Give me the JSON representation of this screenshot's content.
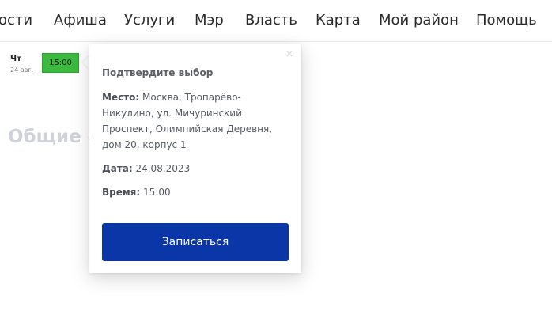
{
  "nav": {
    "items": [
      "ости",
      "Афиша",
      "Услуги",
      "Мэр",
      "Власть",
      "Карта",
      "Мой район",
      "Помощь"
    ]
  },
  "schedule": {
    "day_name": "Чт",
    "day_date": "24 авг.",
    "slot_time": "15:00"
  },
  "section": {
    "heading": "Общие с"
  },
  "popup": {
    "close_glyph": "×",
    "title": "Подтвердите выбор",
    "place_label": "Место:",
    "place_value": "Москва, Тропарёво-Никулино, ул. Мичуринский Проспект, Олимпийская Деревня, дом 20, корпус 1",
    "date_label": "Дата:",
    "date_value": "24.08.2023",
    "time_label": "Время:",
    "time_value": "15:00",
    "submit_label": "Записаться"
  },
  "colors": {
    "slot_selected": "#3cb940",
    "primary_button": "#0b36a8"
  }
}
